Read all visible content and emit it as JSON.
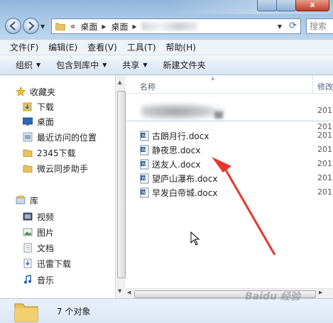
{
  "window": {
    "close_glyph": "x"
  },
  "address": {
    "chevrons": "«",
    "crumbs": [
      "桌面",
      "桌面"
    ],
    "search_placeholder": "搜索"
  },
  "menu": [
    "文件(F)",
    "编辑(E)",
    "查看(V)",
    "工具(T)",
    "帮助(H)"
  ],
  "commands": [
    {
      "label": "组织",
      "dropdown": true
    },
    {
      "label": "包含到库中",
      "dropdown": true
    },
    {
      "label": "共享",
      "dropdown": true
    },
    {
      "label": "新建文件夹",
      "dropdown": false
    }
  ],
  "sidebar": {
    "favorites_header": "收藏夹",
    "favorites": [
      "下载",
      "桌面",
      "最近访问的位置",
      "2345下载",
      "微云同步助手"
    ],
    "library_header": "库",
    "libraries": [
      "视频",
      "图片",
      "文档",
      "迅雷下载",
      "音乐"
    ]
  },
  "list": {
    "col_name": "名称",
    "col_date": "修改",
    "files": [
      {
        "name": "",
        "date": "201",
        "blurred": true
      },
      {
        "name": "古朗月行.docx",
        "date": "201"
      },
      {
        "name": "静夜思.docx",
        "date": "201"
      },
      {
        "name": "送友人.docx",
        "date": "201"
      },
      {
        "name": "望庐山瀑布.docx",
        "date": "201"
      },
      {
        "name": "早发白帝城.docx",
        "date": "201"
      }
    ],
    "header_date_stub": "201"
  },
  "status": {
    "count": "7 个对象"
  },
  "watermark": "Baidu 经验",
  "colors": {
    "titlebar": "#a9c8e6",
    "arrow": "#e8362b",
    "command_bar": "#e4ecf7"
  },
  "icons": [
    "back-arrow-icon",
    "forward-arrow-icon",
    "folder-icon",
    "refresh-icon",
    "star-icon",
    "download-folder-icon",
    "desktop-icon",
    "recent-places-icon",
    "library-icon",
    "video-icon",
    "picture-icon",
    "document-icon",
    "music-icon",
    "word-document-icon"
  ]
}
